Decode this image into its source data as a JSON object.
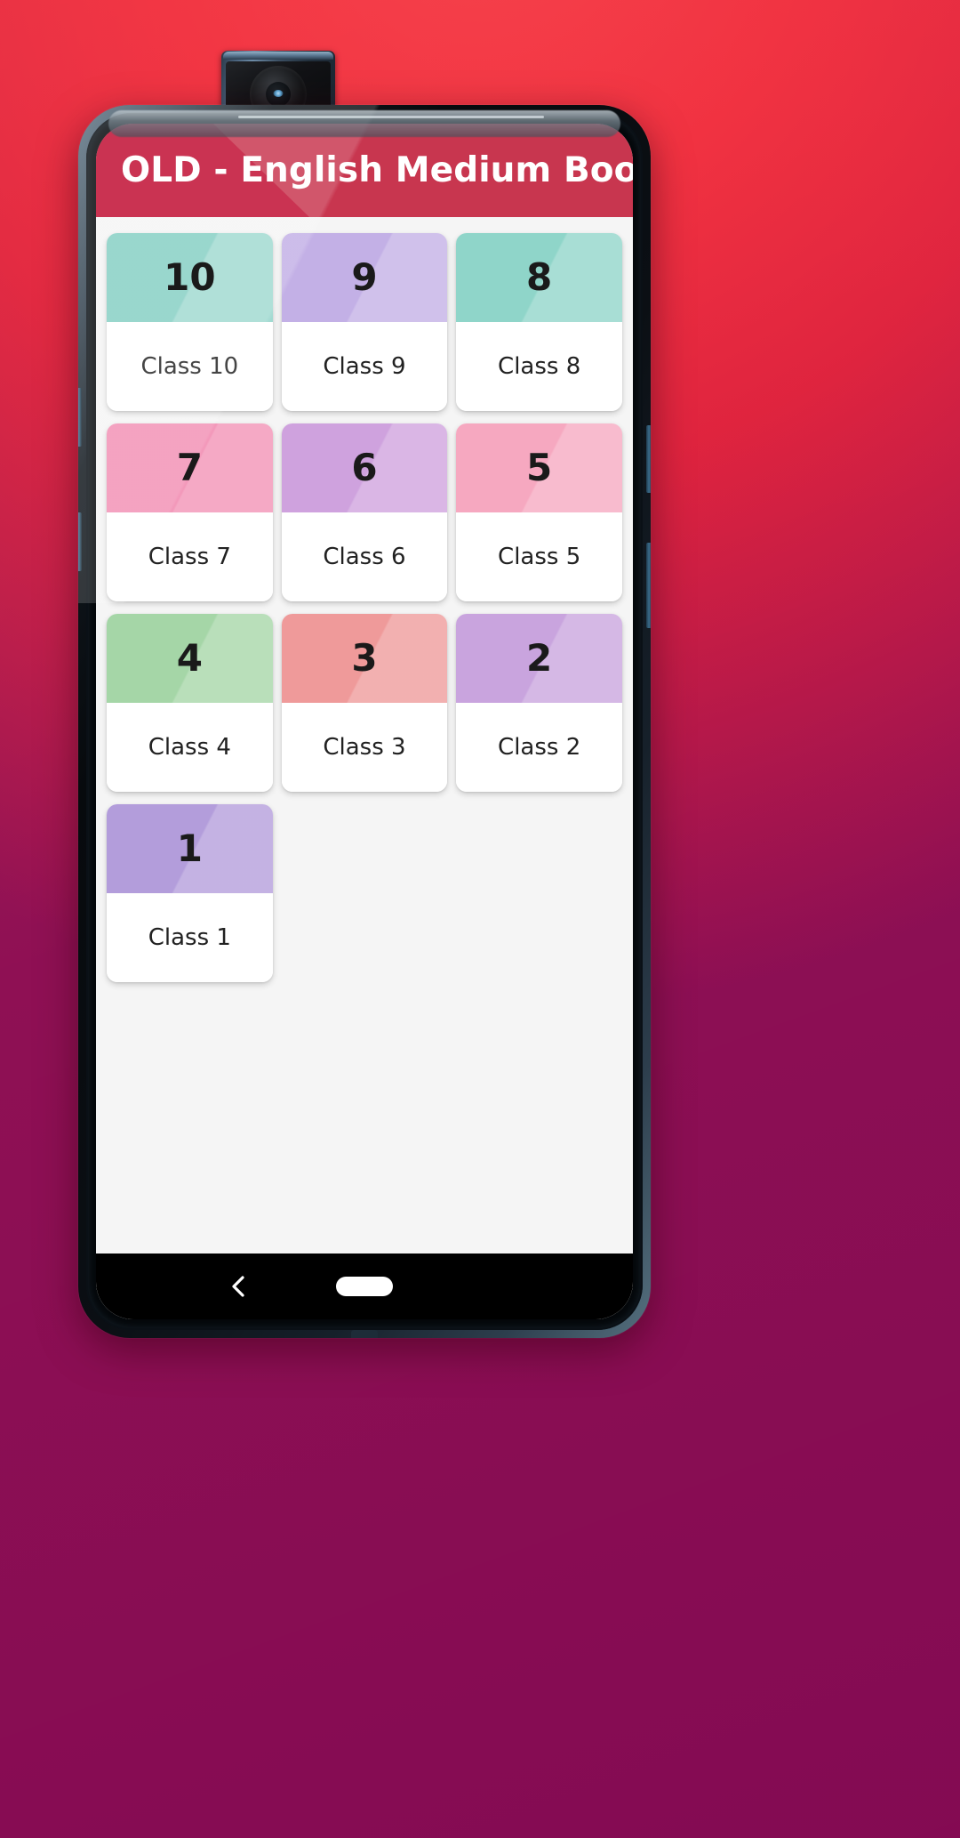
{
  "app": {
    "title": "OLD - English Medium Book",
    "appbar_bg": "#c8364f",
    "appbar_wedge": "#c00c31",
    "overflow_icon": "more-vert-icon",
    "screen_bg": "#f5f5f5"
  },
  "grid": {
    "cards": [
      {
        "number": "10",
        "label": "Class 10",
        "color": "#86cfc4"
      },
      {
        "number": "9",
        "label": "Class 9",
        "color": "#c3b0e6"
      },
      {
        "number": "8",
        "label": "Class 8",
        "color": "#8fd5c9"
      },
      {
        "number": "7",
        "label": "Class 7",
        "color": "#f291b5"
      },
      {
        "number": "6",
        "label": "Class 6",
        "color": "#cfa2de"
      },
      {
        "number": "5",
        "label": "Class 5",
        "color": "#f6a8c0"
      },
      {
        "number": "4",
        "label": "Class 4",
        "color": "#a5d6a7"
      },
      {
        "number": "3",
        "label": "Class 3",
        "color": "#ef9a9a"
      },
      {
        "number": "2",
        "label": "Class 2",
        "color": "#c9a4de"
      },
      {
        "number": "1",
        "label": "Class 1",
        "color": "#b39ddb"
      }
    ]
  },
  "navbar": {
    "back_icon": "chevron-left-icon",
    "home_icon": "home-pill-icon"
  },
  "device": {
    "camera_icon": "popup-camera-icon",
    "wallpaper_color": "#dc1f3c"
  }
}
